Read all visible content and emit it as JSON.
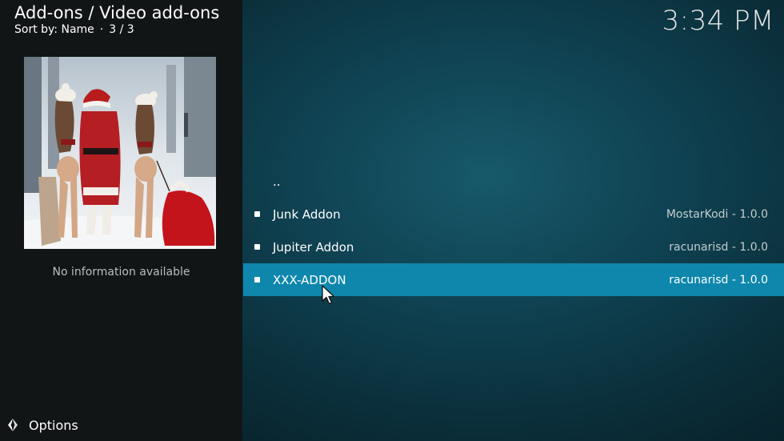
{
  "header": {
    "breadcrumb": "Add-ons / Video add-ons",
    "sort_label": "Sort by: Name",
    "position": "3 / 3",
    "clock": "3:34 PM"
  },
  "info_panel": {
    "no_info_text": "No information available"
  },
  "footer": {
    "options_label": "Options"
  },
  "list": {
    "parent_label": "..",
    "items": [
      {
        "name": "Junk Addon",
        "meta": "MostarKodi - 1.0.0"
      },
      {
        "name": "Jupiter Addon",
        "meta": "racunarisd - 1.0.0"
      },
      {
        "name": "XXX-ADDON",
        "meta": "racunarisd - 1.0.0",
        "selected": true
      }
    ]
  },
  "colors": {
    "selected_row": "#0f86ab",
    "left_panel": "#121516",
    "background_center": "#17596a"
  }
}
